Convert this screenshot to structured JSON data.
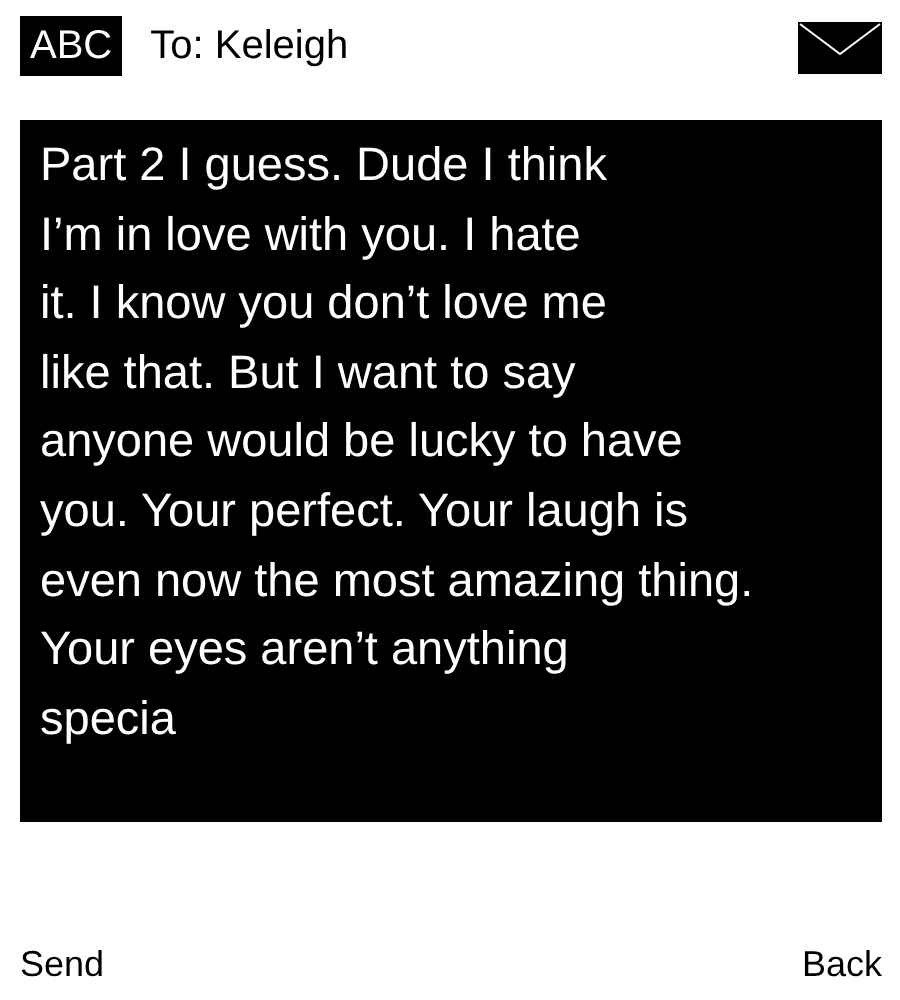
{
  "header": {
    "input_mode": "ABC",
    "recipient": "To: Keleigh"
  },
  "message": "Part 2 I guess. Dude I think\nI’m in love with you. I hate\nit. I know you don’t love me\nlike that. But I want to say\nanyone would be lucky to have\nyou. Your perfect. Your laugh is\neven now the most amazing thing.\nYour eyes aren’t anything\nspecia",
  "softkeys": {
    "left": "Send",
    "right": "Back"
  }
}
